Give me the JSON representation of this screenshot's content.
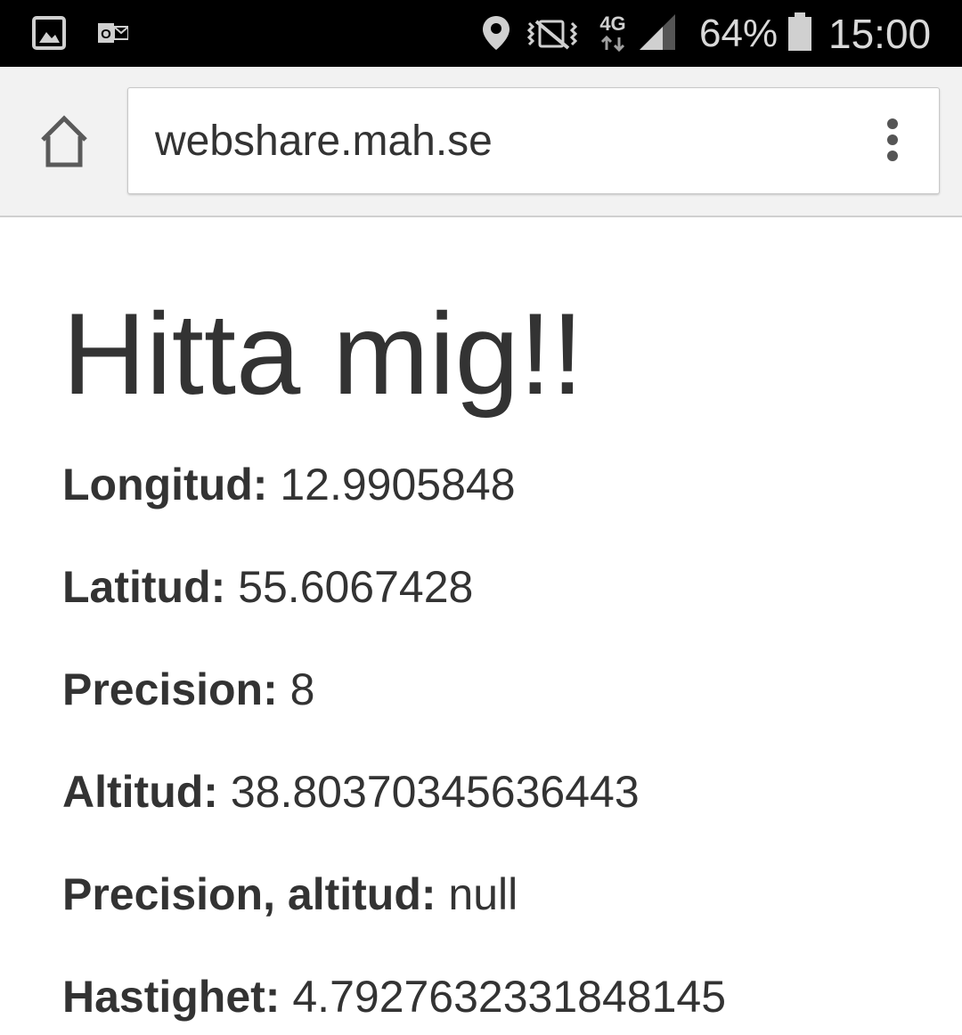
{
  "status_bar": {
    "icons_left": [
      "gallery-icon",
      "outlook-icon"
    ],
    "icons_right": [
      "location-icon",
      "vibrate-icon",
      "network-4g-icon",
      "signal-icon",
      "battery-icon"
    ],
    "network_label": "4G",
    "battery_percent": "64%",
    "time": "15:00"
  },
  "toolbar": {
    "url": "webshare.mah.se",
    "home_icon": "home-icon",
    "menu_icon": "more-vert-icon"
  },
  "page": {
    "title": "Hitta mig!!",
    "fields": [
      {
        "label": "Longitud:",
        "value": "12.9905848"
      },
      {
        "label": "Latitud:",
        "value": "55.6067428"
      },
      {
        "label": "Precision:",
        "value": "8"
      },
      {
        "label": "Altitud:",
        "value": "38.80370345636443"
      },
      {
        "label": "Precision, altitud:",
        "value": "null"
      },
      {
        "label": "Hastighet:",
        "value": "4.792763233184814​5"
      }
    ]
  },
  "colors": {
    "status_bar_bg": "#000000",
    "toolbar_bg": "#f2f2f2",
    "text": "#333333"
  }
}
